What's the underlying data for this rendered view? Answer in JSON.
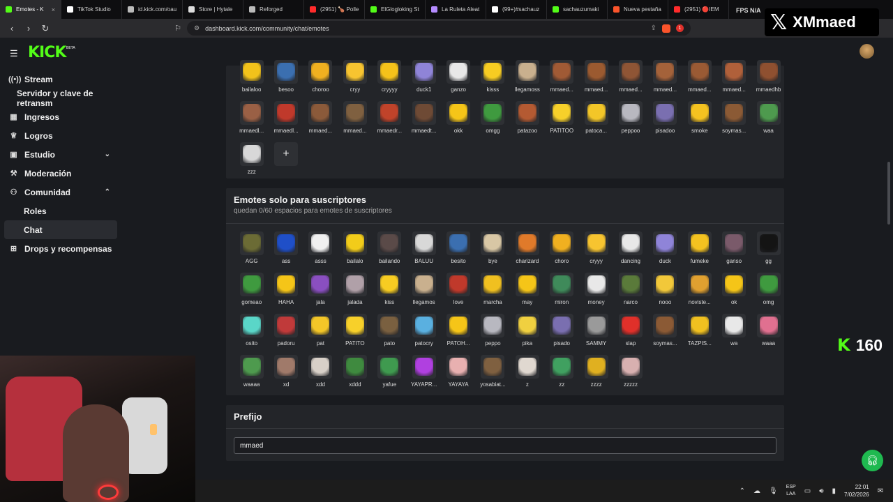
{
  "browser": {
    "tabs": [
      {
        "label": "Emotes - K",
        "color": "#53fc18"
      },
      {
        "label": "TikTok Studio",
        "color": "#ffffff"
      },
      {
        "label": "id.kick.com/oau",
        "color": "#bbbbbb"
      },
      {
        "label": "Store | Hytale",
        "color": "#dddddd"
      },
      {
        "label": "Reforged",
        "color": "#bbbbbb"
      },
      {
        "label": "(2951) 🍗 Polle",
        "color": "#ff2b2b"
      },
      {
        "label": "ElGlogloking St",
        "color": "#53fc18"
      },
      {
        "label": "La Ruleta Aleat",
        "color": "#b58cff"
      },
      {
        "label": "(99+)#sachauz",
        "color": "#ffffff"
      },
      {
        "label": "sachauzumaki",
        "color": "#53fc18"
      },
      {
        "label": "Nueva pestaña",
        "color": "#fb542b"
      },
      {
        "label": "(2951) 🔴IEM",
        "color": "#ff2b2b"
      }
    ],
    "url": "dashboard.kick.com/community/chat/emotes",
    "fps_label": "FPS",
    "fps_value": "N/A",
    "shield_badge": "1"
  },
  "overlay": {
    "x_logo": "𝕏",
    "x_handle": "XMmaed",
    "counter_logo": "K",
    "counter_value": "160"
  },
  "header": {
    "logo": "KICK",
    "beta": "BETA"
  },
  "sidebar": {
    "items": [
      {
        "label": "Stream",
        "icon": "broadcast-icon"
      },
      {
        "label": "Servidor y clave de retransm"
      },
      {
        "label": "Ingresos",
        "icon": "chart-icon"
      },
      {
        "label": "Logros",
        "icon": "trophy-icon"
      },
      {
        "label": "Estudio",
        "icon": "studio-icon"
      },
      {
        "label": "Moderación",
        "icon": "wrench-icon"
      },
      {
        "label": "Comunidad",
        "icon": "community-icon"
      },
      {
        "label": "Roles"
      },
      {
        "label": "Chat"
      },
      {
        "label": "Drops y recompensas",
        "icon": "drops-icon"
      }
    ]
  },
  "channel_emotes": {
    "emotes": [
      {
        "name": "bailaloo",
        "color": "#f2c21b"
      },
      {
        "name": "besoo",
        "color": "#3b6fb0"
      },
      {
        "name": "choroo",
        "color": "#f0b020"
      },
      {
        "name": "cryy",
        "color": "#f7c430"
      },
      {
        "name": "cryyyy",
        "color": "#f5c21a"
      },
      {
        "name": "duck1",
        "color": "#8f84d8"
      },
      {
        "name": "ganzo",
        "color": "#e8e8e8"
      },
      {
        "name": "kisss",
        "color": "#f7cc22"
      },
      {
        "name": "llegamoss",
        "color": "#c9b08e"
      },
      {
        "name": "mmaed...",
        "color": "#a05a35"
      },
      {
        "name": "mmaed...",
        "color": "#9b5a30"
      },
      {
        "name": "mmaed...",
        "color": "#8f5535"
      },
      {
        "name": "mmaed...",
        "color": "#a4623a"
      },
      {
        "name": "mmaed...",
        "color": "#9a5a34"
      },
      {
        "name": "mmaed...",
        "color": "#b0603a"
      },
      {
        "name": "mmaedhb",
        "color": "#8f5030"
      },
      {
        "name": "mmaedl...",
        "color": "#9a6045"
      },
      {
        "name": "mmaedl...",
        "color": "#c0392b"
      },
      {
        "name": "mmaed...",
        "color": "#8b5a3a"
      },
      {
        "name": "mmaed...",
        "color": "#7f6040"
      },
      {
        "name": "mmaedr...",
        "color": "#c0432a"
      },
      {
        "name": "mmaedt...",
        "color": "#6e4a35"
      },
      {
        "name": "okk",
        "color": "#f5c518"
      },
      {
        "name": "omgg",
        "color": "#3f9a3f"
      },
      {
        "name": "patazoo",
        "color": "#b45a32"
      },
      {
        "name": "PATITOO",
        "color": "#f7d02a"
      },
      {
        "name": "patoca...",
        "color": "#f3c628"
      },
      {
        "name": "peppoo",
        "color": "#b8b8c0"
      },
      {
        "name": "pisadoo",
        "color": "#7a6fb0"
      },
      {
        "name": "smoke",
        "color": "#f4c220"
      },
      {
        "name": "soymas...",
        "color": "#8b5a35"
      },
      {
        "name": "waa",
        "color": "#4e9a4e"
      },
      {
        "name": "zzz",
        "color": "#d8d8d8"
      }
    ]
  },
  "sub_emotes": {
    "title": "Emotes solo para suscriptores",
    "subtitle": "quedan 0/60 espacios para emotes de suscriptores",
    "emotes": [
      {
        "name": "AGG",
        "color": "#6b6b35"
      },
      {
        "name": "ass",
        "color": "#1f4fc8"
      },
      {
        "name": "asss",
        "color": "#f0f0f0"
      },
      {
        "name": "bailalo",
        "color": "#f2cc1a"
      },
      {
        "name": "bailando",
        "color": "#5a4a48"
      },
      {
        "name": "BALUU",
        "color": "#d8d8d8"
      },
      {
        "name": "besito",
        "color": "#3b6fb0"
      },
      {
        "name": "bye",
        "color": "#d8c7a5"
      },
      {
        "name": "charizard",
        "color": "#e07a2a"
      },
      {
        "name": "choro",
        "color": "#f0b020"
      },
      {
        "name": "cryyy",
        "color": "#f7c430"
      },
      {
        "name": "dancing",
        "color": "#e8e8e8"
      },
      {
        "name": "duck",
        "color": "#8f84d8"
      },
      {
        "name": "fumeke",
        "color": "#f4c220"
      },
      {
        "name": "ganso",
        "color": "#7a5a6a"
      },
      {
        "name": "gg",
        "color": "#141414"
      },
      {
        "name": "gomeao",
        "color": "#3f9a3f"
      },
      {
        "name": "HAHA",
        "color": "#f5c518"
      },
      {
        "name": "jala",
        "color": "#8a4fc0"
      },
      {
        "name": "jalada",
        "color": "#b0a0a8"
      },
      {
        "name": "kiss",
        "color": "#f7cc22"
      },
      {
        "name": "llegamos",
        "color": "#c9b08e"
      },
      {
        "name": "love",
        "color": "#c0392b"
      },
      {
        "name": "marcha",
        "color": "#f0c020"
      },
      {
        "name": "may",
        "color": "#f5c518"
      },
      {
        "name": "miron",
        "color": "#3f8a5a"
      },
      {
        "name": "money",
        "color": "#e8e8e8"
      },
      {
        "name": "narco",
        "color": "#5a7a3a"
      },
      {
        "name": "nooo",
        "color": "#f2c83a"
      },
      {
        "name": "noviste...",
        "color": "#e0a030"
      },
      {
        "name": "ok",
        "color": "#f5c518"
      },
      {
        "name": "omg",
        "color": "#3f9a3f"
      },
      {
        "name": "osito",
        "color": "#5ad6c8"
      },
      {
        "name": "padoru",
        "color": "#c03a3a"
      },
      {
        "name": "pat",
        "color": "#f3c628"
      },
      {
        "name": "PATITO",
        "color": "#f7d02a"
      },
      {
        "name": "pato",
        "color": "#7a6040"
      },
      {
        "name": "patocry",
        "color": "#5ab0e0"
      },
      {
        "name": "PATOH...",
        "color": "#f5c518"
      },
      {
        "name": "peppo",
        "color": "#b8b8c0"
      },
      {
        "name": "pika",
        "color": "#f0d040"
      },
      {
        "name": "pisado",
        "color": "#7a6fb0"
      },
      {
        "name": "SAMMY",
        "color": "#9a9a9a"
      },
      {
        "name": "slap",
        "color": "#e0302a"
      },
      {
        "name": "soymas...",
        "color": "#8b5a35"
      },
      {
        "name": "TAZPIS...",
        "color": "#f0c020"
      },
      {
        "name": "wa",
        "color": "#e8e8e8"
      },
      {
        "name": "waaa",
        "color": "#e07090"
      },
      {
        "name": "waaaa",
        "color": "#4e9a4e"
      },
      {
        "name": "xd",
        "color": "#a07a6a"
      },
      {
        "name": "xdd",
        "color": "#d8d0c8"
      },
      {
        "name": "xddd",
        "color": "#3f8a3f"
      },
      {
        "name": "yafue",
        "color": "#3f9a4f"
      },
      {
        "name": "YAYAPR...",
        "color": "#b040e0"
      },
      {
        "name": "YAYAYA",
        "color": "#e8b0b0"
      },
      {
        "name": "yosabiat...",
        "color": "#7f6040"
      },
      {
        "name": "z",
        "color": "#e0d8d0"
      },
      {
        "name": "zz",
        "color": "#40a060"
      },
      {
        "name": "zzzz",
        "color": "#e0b020"
      },
      {
        "name": "zzzzz",
        "color": "#d8b0b0"
      }
    ]
  },
  "prefix": {
    "title": "Prefijo",
    "value": "mmaed"
  },
  "taskbar": {
    "lang_top": "ESP",
    "lang_bottom": "LAA",
    "time": "22:01",
    "date": "7/02/2026"
  }
}
